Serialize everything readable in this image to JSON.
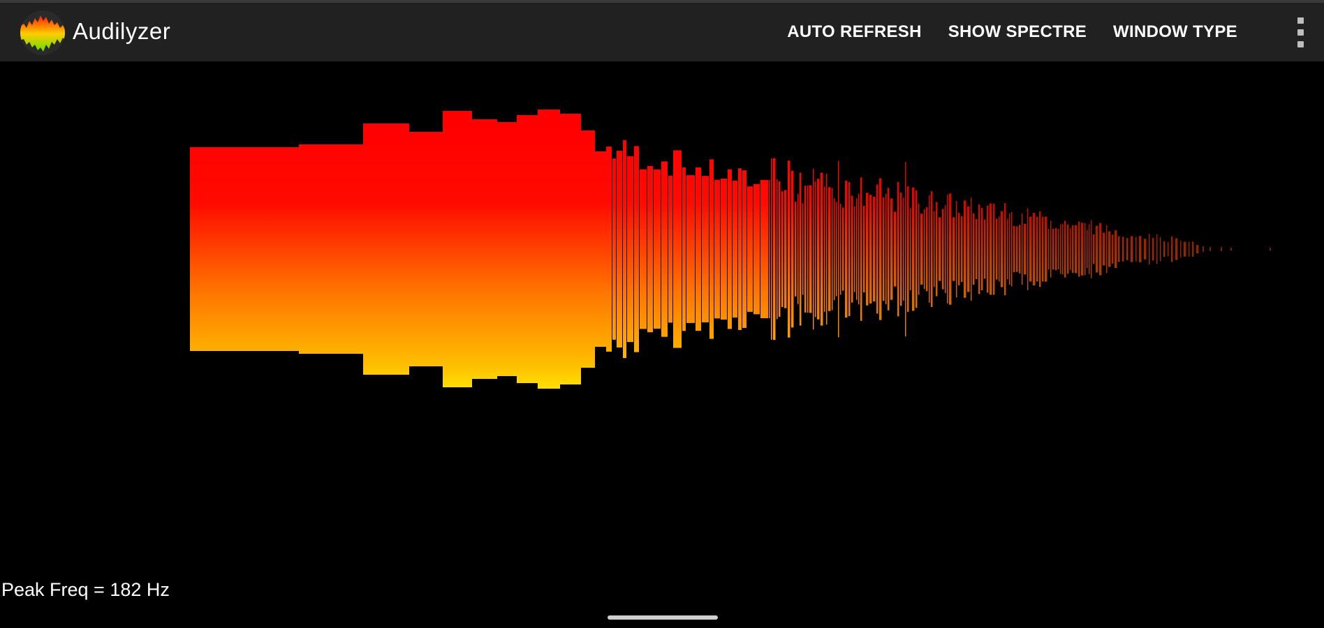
{
  "app": {
    "title": "Audilyzer"
  },
  "toolbar": {
    "actions": [
      {
        "label": "AUTO REFRESH"
      },
      {
        "label": "SHOW SPECTRE"
      },
      {
        "label": "WINDOW TYPE"
      }
    ],
    "overflow_icon": "more-vert-icon"
  },
  "status": {
    "peak_freq": "Peak Freq = 182 Hz"
  },
  "colors": {
    "toolbar": "#212121",
    "background": "#000000",
    "gradient_top": "#ff0000",
    "gradient_mid": "#ff8c00",
    "gradient_low": "#ffff00",
    "gradient_bottom": "#7fff00"
  }
}
